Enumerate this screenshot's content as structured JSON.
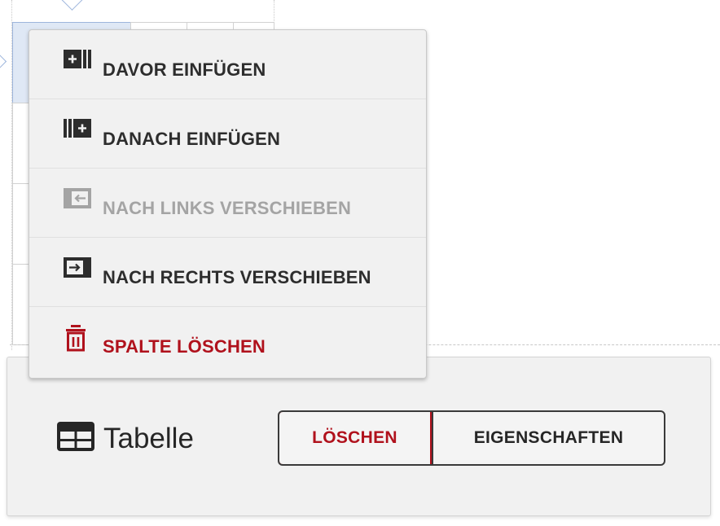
{
  "popup_menu": {
    "items": [
      {
        "label": "DAVOR EINFÜGEN",
        "icon": "insert-column-before-icon",
        "state": "enabled"
      },
      {
        "label": "DANACH EINFÜGEN",
        "icon": "insert-column-after-icon",
        "state": "enabled"
      },
      {
        "label": "NACH LINKS VERSCHIEBEN",
        "icon": "move-left-icon",
        "state": "disabled"
      },
      {
        "label": "NACH RECHTS VERSCHIEBEN",
        "icon": "move-right-icon",
        "state": "enabled"
      },
      {
        "label": "SPALTE LÖSCHEN",
        "icon": "trash-icon",
        "state": "danger"
      }
    ]
  },
  "toolbar": {
    "block_icon": "table-icon",
    "block_label": "Tabelle",
    "delete_label": "LÖSCHEN",
    "properties_label": "EIGENSCHAFTEN"
  },
  "colors": {
    "danger": "#b0111c",
    "text": "#2d2d2d",
    "disabled": "#a4a4a4",
    "selection": "#dfe8f5",
    "panel_bg": "#f1f1f1"
  }
}
